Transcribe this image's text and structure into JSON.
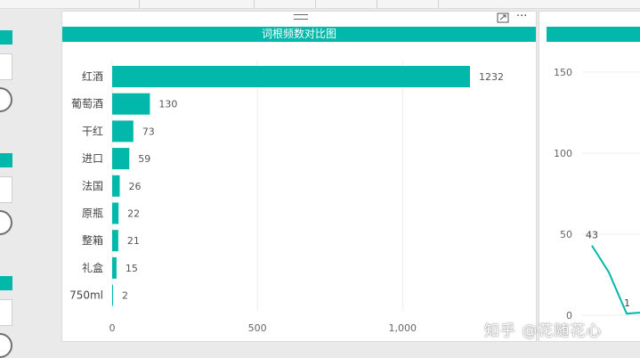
{
  "chart_data": {
    "type": "bar",
    "orientation": "horizontal",
    "title": "词根频数对比图",
    "categories": [
      "红酒",
      "葡萄酒",
      "干红",
      "进口",
      "法国",
      "原瓶",
      "整箱",
      "礼盒",
      "750ml"
    ],
    "values": [
      1232,
      130,
      73,
      59,
      26,
      22,
      21,
      15,
      2
    ],
    "data_labels": [
      "1232",
      "130",
      "73",
      "59",
      "26",
      "22",
      "21",
      "15",
      "2"
    ],
    "xlim": [
      0,
      1232
    ],
    "x_ticks": [
      0,
      500,
      1000
    ],
    "x_tick_labels": [
      "0",
      "500",
      "1,000"
    ],
    "grid": true,
    "bar_color": "#01b8aa"
  },
  "side_chart": {
    "type": "line",
    "y_ticks": [
      0,
      50,
      100,
      150
    ],
    "y_tick_labels": [
      "0",
      "50",
      "100",
      "150"
    ],
    "ylim": [
      0,
      150
    ],
    "point_labels": [
      "43",
      "1"
    ],
    "line_color": "#01b8aa"
  },
  "toolbar": {
    "more_glyph": "···"
  },
  "watermark": "知乎 @花随花心",
  "colors": {
    "accent": "#01b8aa",
    "background": "#eaeaea"
  }
}
